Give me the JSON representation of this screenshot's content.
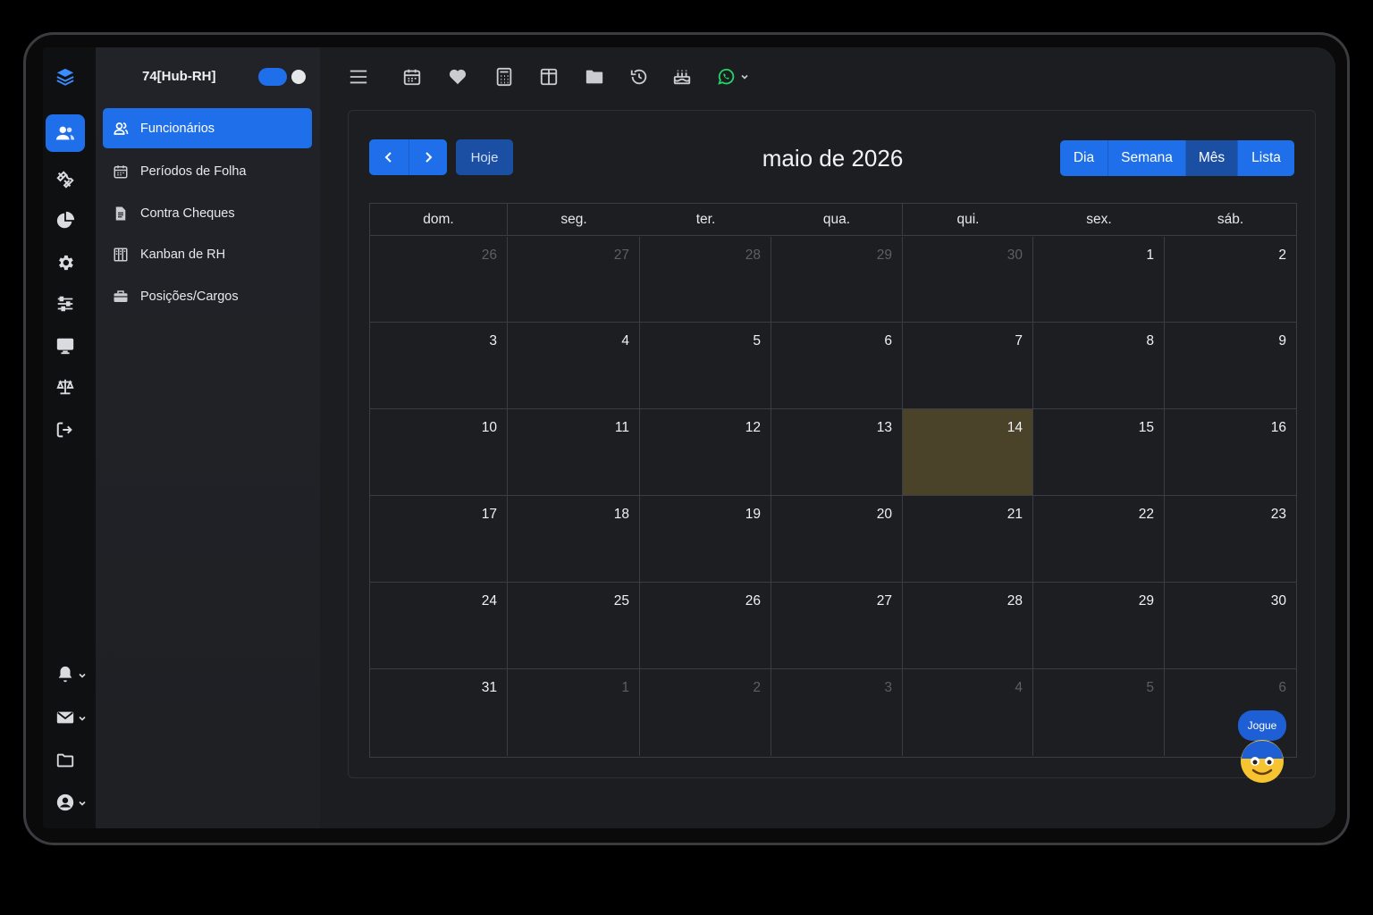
{
  "app": {
    "workspace_title": "74[Hub-RH]",
    "workspace_toggle_on": true
  },
  "colors": {
    "accent": "#1f6feb",
    "accent_dark": "#1b4fa3",
    "today_highlight": "#4a4229",
    "whatsapp": "#25d366"
  },
  "rail": {
    "items": [
      {
        "icon": "layers-logo-icon"
      },
      {
        "icon": "users-icon",
        "active": true
      },
      {
        "icon": "tools-icon"
      },
      {
        "icon": "pie-chart-icon"
      },
      {
        "icon": "gear-icon"
      },
      {
        "icon": "sliders-icon"
      },
      {
        "icon": "monitor-icon"
      },
      {
        "icon": "scale-icon"
      },
      {
        "icon": "logout-icon"
      }
    ],
    "bottom_items": [
      {
        "icon": "bell-icon",
        "dropdown": true
      },
      {
        "icon": "mail-icon",
        "dropdown": true
      },
      {
        "icon": "folder-icon",
        "dropdown": false
      },
      {
        "icon": "user-circle-icon",
        "dropdown": true
      }
    ]
  },
  "sidebar": {
    "items": [
      {
        "label": "Funcionários",
        "icon": "user-group-icon",
        "active": true
      },
      {
        "label": "Períodos de Folha",
        "icon": "calendar-icon"
      },
      {
        "label": "Contra Cheques",
        "icon": "document-icon"
      },
      {
        "label": "Kanban de RH",
        "icon": "kanban-icon"
      },
      {
        "label": "Posições/Cargos",
        "icon": "briefcase-icon"
      }
    ]
  },
  "toolbar": {
    "icons": [
      "menu-icon",
      "calendar-icon",
      "heart-icon",
      "calculator-icon",
      "columns-icon",
      "folder-icon",
      "history-icon",
      "birthday-cake-icon",
      "whatsapp-icon"
    ]
  },
  "calendar": {
    "title": "maio de 2026",
    "today_label": "Hoje",
    "prev_icon": "chevron-left-icon",
    "next_icon": "chevron-right-icon",
    "views": [
      {
        "label": "Dia",
        "active": false
      },
      {
        "label": "Semana",
        "active": false
      },
      {
        "label": "Mês",
        "active": true
      },
      {
        "label": "Lista",
        "active": false
      }
    ],
    "weekdays": [
      "dom.",
      "seg.",
      "ter.",
      "qua.",
      "qui.",
      "sex.",
      "sáb."
    ],
    "weeks": [
      [
        {
          "d": "26",
          "other": true
        },
        {
          "d": "27",
          "other": true
        },
        {
          "d": "28",
          "other": true
        },
        {
          "d": "29",
          "other": true
        },
        {
          "d": "30",
          "other": true
        },
        {
          "d": "1"
        },
        {
          "d": "2"
        }
      ],
      [
        {
          "d": "3"
        },
        {
          "d": "4"
        },
        {
          "d": "5"
        },
        {
          "d": "6"
        },
        {
          "d": "7"
        },
        {
          "d": "8"
        },
        {
          "d": "9"
        }
      ],
      [
        {
          "d": "10"
        },
        {
          "d": "11"
        },
        {
          "d": "12"
        },
        {
          "d": "13"
        },
        {
          "d": "14",
          "today": true
        },
        {
          "d": "15"
        },
        {
          "d": "16"
        }
      ],
      [
        {
          "d": "17"
        },
        {
          "d": "18"
        },
        {
          "d": "19"
        },
        {
          "d": "20"
        },
        {
          "d": "21"
        },
        {
          "d": "22"
        },
        {
          "d": "23"
        }
      ],
      [
        {
          "d": "24"
        },
        {
          "d": "25"
        },
        {
          "d": "26"
        },
        {
          "d": "27"
        },
        {
          "d": "28"
        },
        {
          "d": "29"
        },
        {
          "d": "30"
        }
      ],
      [
        {
          "d": "31"
        },
        {
          "d": "1",
          "other": true
        },
        {
          "d": "2",
          "other": true
        },
        {
          "d": "3",
          "other": true
        },
        {
          "d": "4",
          "other": true
        },
        {
          "d": "5",
          "other": true
        },
        {
          "d": "6",
          "other": true
        }
      ]
    ]
  },
  "mascot": {
    "badge_label": "Jogue"
  }
}
